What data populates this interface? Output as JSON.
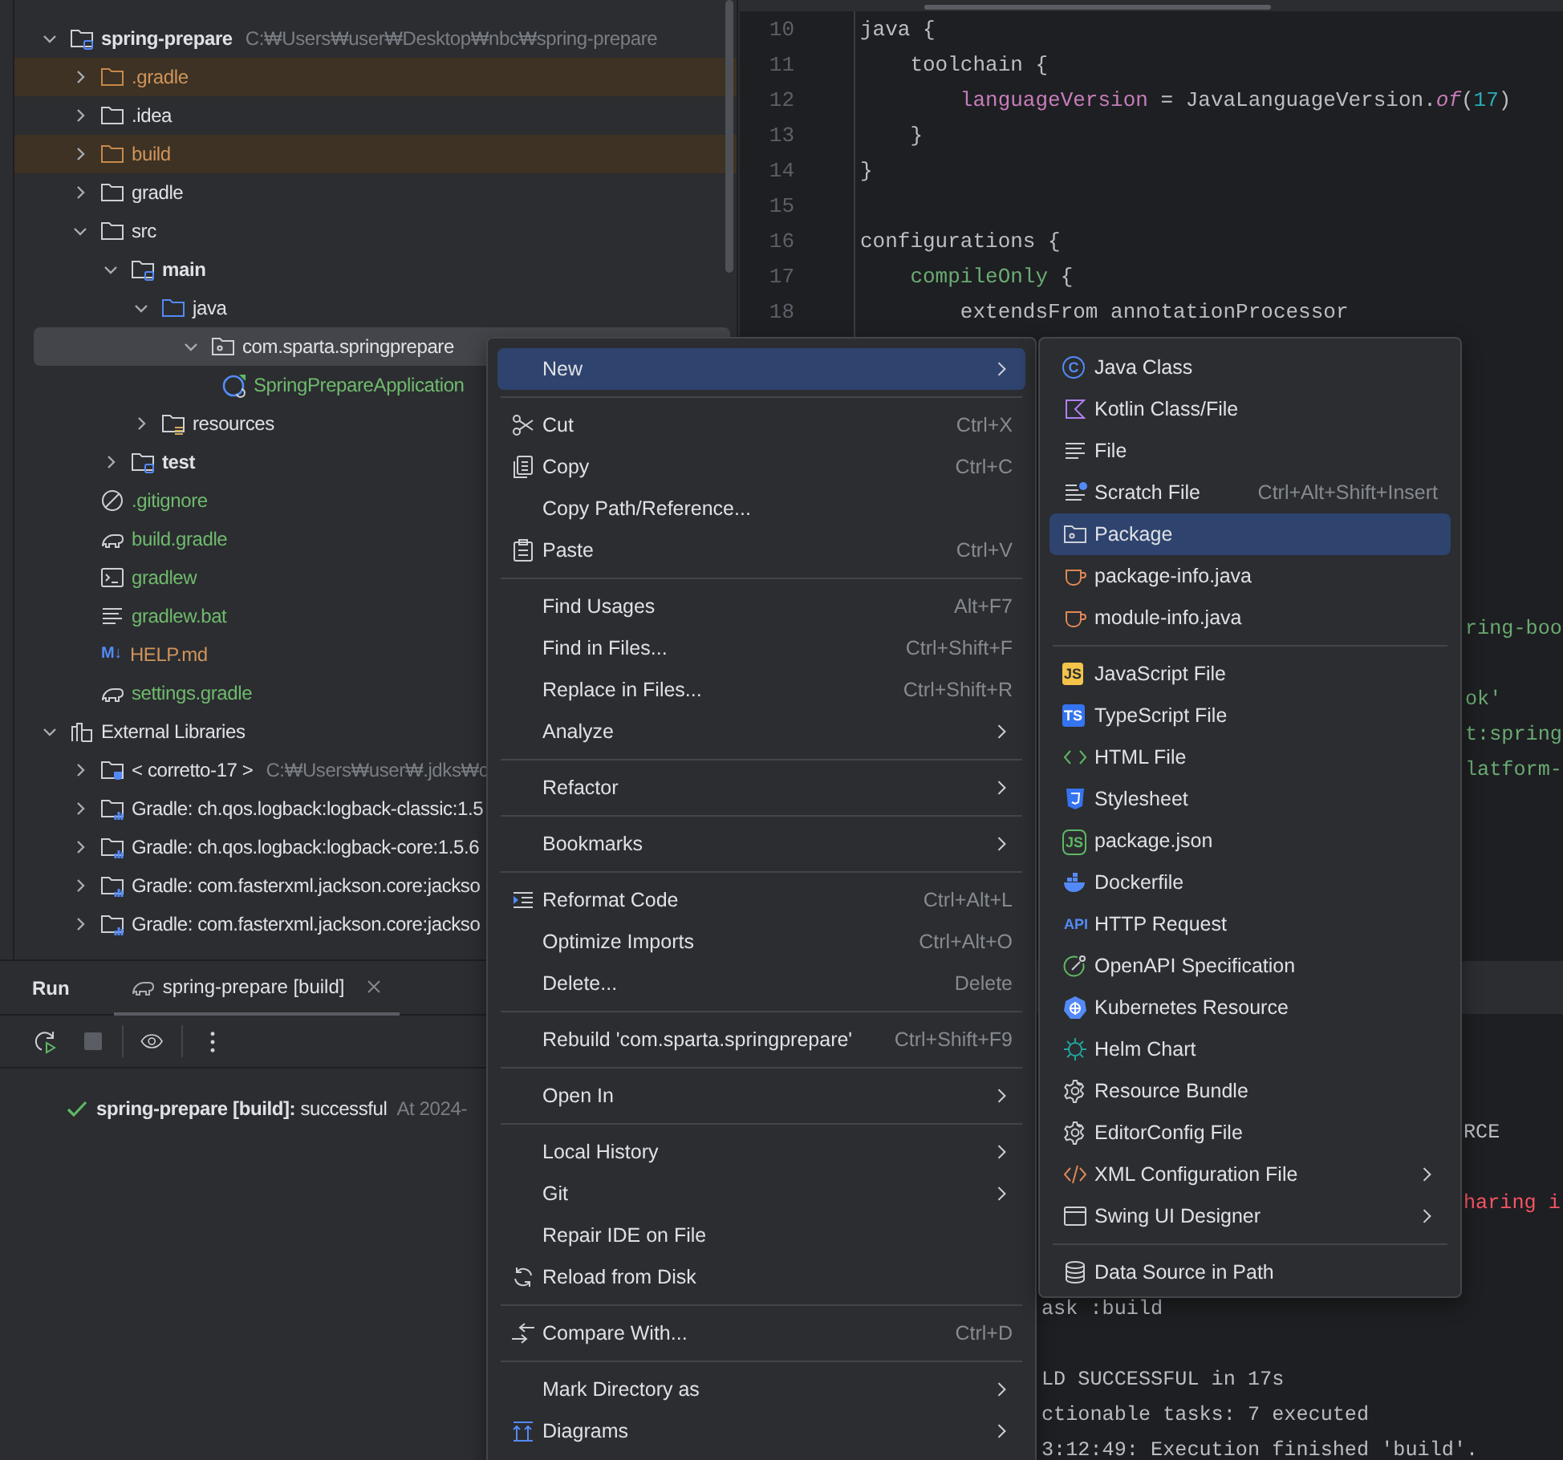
{
  "project_tree": {
    "items": [
      {
        "label": "spring-prepare",
        "hint": "C:₩Users₩user₩Desktop₩nbc₩spring-prepare",
        "kind": "module",
        "color": "#dfe1e5",
        "excluded": false,
        "expanded": true,
        "selected": false,
        "children": [
          {
            "label": ".gradle",
            "kind": "folder",
            "color": "#d0945c",
            "excluded": true,
            "expanded": false,
            "selected": false
          },
          {
            "label": ".idea",
            "kind": "folder",
            "color": "#dfe1e5",
            "excluded": false,
            "expanded": false,
            "selected": false
          },
          {
            "label": "build",
            "kind": "folder",
            "color": "#d0945c",
            "excluded": true,
            "expanded": false,
            "selected": false
          },
          {
            "label": "gradle",
            "kind": "folder",
            "color": "#dfe1e5",
            "excluded": false,
            "expanded": false,
            "selected": false
          },
          {
            "label": "src",
            "kind": "folder",
            "color": "#dfe1e5",
            "excluded": false,
            "expanded": true,
            "selected": false,
            "children": [
              {
                "label": "main",
                "kind": "module",
                "color": "#dfe1e5",
                "excluded": false,
                "expanded": true,
                "selected": false,
                "children": [
                  {
                    "label": "java",
                    "kind": "source",
                    "color": "#dfe1e5",
                    "excluded": false,
                    "expanded": true,
                    "selected": false,
                    "children": [
                      {
                        "label": "com.sparta.springprepare",
                        "kind": "package",
                        "color": "#dfe1e5",
                        "excluded": false,
                        "expanded": true,
                        "selected": true,
                        "children": [
                          {
                            "label": "SpringPrepareApplication",
                            "kind": "spring-class",
                            "color": "#6fba6d",
                            "excluded": false,
                            "selected": false
                          }
                        ]
                      }
                    ]
                  },
                  {
                    "label": "resources",
                    "kind": "resources",
                    "color": "#dfe1e5",
                    "excluded": false,
                    "expanded": false,
                    "selected": false
                  }
                ]
              },
              {
                "label": "test",
                "kind": "module",
                "color": "#dfe1e5",
                "excluded": false,
                "expanded": false,
                "selected": false
              }
            ]
          },
          {
            "label": ".gitignore",
            "kind": "ignore",
            "color": "#6fba6d",
            "excluded": false,
            "selected": false
          },
          {
            "label": "build.gradle",
            "kind": "gradle",
            "color": "#6fba6d",
            "excluded": false,
            "selected": false
          },
          {
            "label": "gradlew",
            "kind": "terminal",
            "color": "#6fba6d",
            "excluded": false,
            "selected": false
          },
          {
            "label": "gradlew.bat",
            "kind": "text",
            "color": "#6fba6d",
            "excluded": false,
            "selected": false
          },
          {
            "label": "HELP.md",
            "kind": "markdown",
            "badge": "M↓",
            "color": "#d0945c",
            "excluded": false,
            "selected": false
          },
          {
            "label": "settings.gradle",
            "kind": "gradle",
            "color": "#6fba6d",
            "excluded": false,
            "selected": false
          }
        ]
      },
      {
        "label": "External Libraries",
        "kind": "libraries",
        "color": "#dfe1e5",
        "excluded": false,
        "expanded": true,
        "selected": false,
        "children": [
          {
            "label": "< corretto-17 >",
            "hint": "C:₩Users₩user₩.jdks₩c",
            "kind": "jdk",
            "color": "#dfe1e5",
            "excluded": false,
            "expanded": false,
            "selected": false
          },
          {
            "label": "Gradle: ch.qos.logback:logback-classic:1.5",
            "kind": "library",
            "color": "#dfe1e5",
            "excluded": false,
            "expanded": false,
            "selected": false
          },
          {
            "label": "Gradle: ch.qos.logback:logback-core:1.5.6",
            "kind": "library",
            "color": "#dfe1e5",
            "excluded": false,
            "expanded": false,
            "selected": false
          },
          {
            "label": "Gradle: com.fasterxml.jackson.core:jackso",
            "kind": "library",
            "color": "#dfe1e5",
            "excluded": false,
            "expanded": false,
            "selected": false
          },
          {
            "label": "Gradle: com.fasterxml.jackson.core:jackso",
            "kind": "library",
            "color": "#dfe1e5",
            "excluded": false,
            "expanded": false,
            "selected": false
          }
        ]
      }
    ]
  },
  "editor": {
    "lines": [
      {
        "number": "10",
        "tokens": [
          {
            "text": "java {",
            "kind": "plain"
          }
        ]
      },
      {
        "number": "11",
        "tokens": [
          {
            "text": "    toolchain {",
            "kind": "plain"
          }
        ]
      },
      {
        "number": "12",
        "tokens": [
          {
            "text": "        languageVersion",
            "kind": "property"
          },
          {
            "text": " = JavaLanguageVersion.",
            "kind": "plain"
          },
          {
            "text": "of",
            "kind": "static"
          },
          {
            "text": "(",
            "kind": "plain"
          },
          {
            "text": "17",
            "kind": "number"
          },
          {
            "text": ")",
            "kind": "plain"
          }
        ]
      },
      {
        "number": "13",
        "tokens": [
          {
            "text": "    }",
            "kind": "plain"
          }
        ]
      },
      {
        "number": "14",
        "tokens": [
          {
            "text": "}",
            "kind": "plain"
          }
        ]
      },
      {
        "number": "15"
      },
      {
        "number": "16",
        "tokens": [
          {
            "text": "configurations {",
            "kind": "plain"
          }
        ]
      },
      {
        "number": "17",
        "tokens": [
          {
            "text": "    compileOnly",
            "kind": "call"
          },
          {
            "text": " {",
            "kind": "plain"
          }
        ]
      },
      {
        "number": "18",
        "tokens": [
          {
            "text": "        extendsFrom annotationProcessor",
            "kind": "plain"
          }
        ]
      }
    ],
    "fragments": [
      {
        "text": "ring-boo",
        "kind": "string"
      },
      {
        "text": "ok'",
        "kind": "string"
      },
      {
        "text": "t:spring",
        "kind": "string"
      },
      {
        "text": "latform-",
        "kind": "string"
      }
    ]
  },
  "run_panel": {
    "title": "Run",
    "tabs": [
      {
        "label": "spring-prepare [build]",
        "selected": true
      }
    ],
    "tree": [
      {
        "label": "**spring-prepare [build]:** successful",
        "time": "At 2024-",
        "kind": "success"
      }
    ],
    "console": [
      {
        "text": "RCE",
        "kind": "output"
      },
      {
        "text": "haring i",
        "kind": "error"
      },
      {
        "text": "ask :build",
        "kind": "output"
      },
      {
        "text": "LD SUCCESSFUL in 17s",
        "kind": "output"
      },
      {
        "text": "ctionable tasks: 7 executed",
        "kind": "output"
      },
      {
        "text": "3:12:49: Execution finished 'build'.",
        "kind": "output"
      }
    ]
  },
  "context_menu": {
    "items": [
      {
        "kind": "item",
        "label": "New",
        "submenu": true,
        "selected": true
      },
      {
        "kind": "separator"
      },
      {
        "kind": "cut",
        "label": "Cut",
        "shortcut": "Ctrl+X",
        "submenu": false,
        "selected": false
      },
      {
        "kind": "copy",
        "label": "Copy",
        "shortcut": "Ctrl+C",
        "submenu": false,
        "selected": false
      },
      {
        "kind": "item",
        "label": "Copy Path/Reference...",
        "submenu": false,
        "selected": false
      },
      {
        "kind": "paste",
        "label": "Paste",
        "shortcut": "Ctrl+V",
        "submenu": false,
        "selected": false
      },
      {
        "kind": "separator"
      },
      {
        "kind": "item",
        "label": "Find Usages",
        "shortcut": "Alt+F7",
        "submenu": false,
        "selected": false
      },
      {
        "kind": "item",
        "label": "Find in Files...",
        "shortcut": "Ctrl+Shift+F",
        "submenu": false,
        "selected": false
      },
      {
        "kind": "item",
        "label": "Replace in Files...",
        "shortcut": "Ctrl+Shift+R",
        "submenu": false,
        "selected": false
      },
      {
        "kind": "item",
        "label": "Analyze",
        "submenu": true,
        "selected": false
      },
      {
        "kind": "separator"
      },
      {
        "kind": "item",
        "label": "Refactor",
        "submenu": true,
        "selected": false
      },
      {
        "kind": "separator"
      },
      {
        "kind": "item",
        "label": "Bookmarks",
        "submenu": true,
        "selected": false
      },
      {
        "kind": "separator"
      },
      {
        "kind": "reformat",
        "label": "Reformat Code",
        "shortcut": "Ctrl+Alt+L",
        "submenu": false,
        "selected": false
      },
      {
        "kind": "item",
        "label": "Optimize Imports",
        "shortcut": "Ctrl+Alt+O",
        "submenu": false,
        "selected": false
      },
      {
        "kind": "item",
        "label": "Delete...",
        "shortcut": "Delete",
        "submenu": false,
        "selected": false
      },
      {
        "kind": "separator"
      },
      {
        "kind": "item",
        "label": "Rebuild 'com.sparta.springprepare'",
        "shortcut": "Ctrl+Shift+F9",
        "submenu": false,
        "selected": false
      },
      {
        "kind": "separator"
      },
      {
        "kind": "item",
        "label": "Open In",
        "submenu": true,
        "selected": false
      },
      {
        "kind": "separator"
      },
      {
        "kind": "item",
        "label": "Local History",
        "submenu": true,
        "selected": false
      },
      {
        "kind": "item",
        "label": "Git",
        "submenu": true,
        "selected": false
      },
      {
        "kind": "item",
        "label": "Repair IDE on File",
        "submenu": false,
        "selected": false
      },
      {
        "kind": "reload",
        "label": "Reload from Disk",
        "submenu": false,
        "selected": false
      },
      {
        "kind": "separator"
      },
      {
        "kind": "compare",
        "label": "Compare With...",
        "shortcut": "Ctrl+D",
        "submenu": false,
        "selected": false
      },
      {
        "kind": "separator"
      },
      {
        "kind": "item",
        "label": "Mark Directory as",
        "submenu": true,
        "selected": false
      },
      {
        "kind": "diagrams",
        "label": "Diagrams",
        "submenu": true,
        "selected": false
      }
    ]
  },
  "new_submenu": {
    "items": [
      {
        "kind": "class",
        "label": "Java Class",
        "badge": "C",
        "submenu": false,
        "selected": false
      },
      {
        "kind": "kotlin",
        "label": "Kotlin Class/File",
        "submenu": false,
        "selected": false
      },
      {
        "kind": "text",
        "label": "File",
        "submenu": false,
        "selected": false
      },
      {
        "kind": "scratch",
        "label": "Scratch File",
        "shortcut": "Ctrl+Alt+Shift+Insert",
        "submenu": false,
        "selected": false
      },
      {
        "kind": "package",
        "label": "Package",
        "submenu": false,
        "selected": true
      },
      {
        "kind": "cup",
        "label": "package-info.java",
        "submenu": false,
        "selected": false
      },
      {
        "kind": "cup",
        "label": "module-info.java",
        "submenu": false,
        "selected": false
      },
      {
        "kind": "separator"
      },
      {
        "kind": "js",
        "label": "JavaScript File",
        "badge": "JS",
        "submenu": false,
        "selected": false
      },
      {
        "kind": "ts",
        "label": "TypeScript File",
        "badge": "TS",
        "submenu": false,
        "selected": false
      },
      {
        "kind": "html",
        "label": "HTML File",
        "submenu": false,
        "selected": false
      },
      {
        "kind": "css",
        "label": "Stylesheet",
        "submenu": false,
        "selected": false
      },
      {
        "kind": "node",
        "label": "package.json",
        "badge": "JS",
        "submenu": false,
        "selected": false
      },
      {
        "kind": "docker",
        "label": "Dockerfile",
        "submenu": false,
        "selected": false
      },
      {
        "kind": "api",
        "label": "HTTP Request",
        "badge": "API",
        "submenu": false,
        "selected": false
      },
      {
        "kind": "openapi",
        "label": "OpenAPI Specification",
        "submenu": false,
        "selected": false
      },
      {
        "kind": "kubernetes",
        "label": "Kubernetes Resource",
        "submenu": false,
        "selected": false
      },
      {
        "kind": "helm",
        "label": "Helm Chart",
        "submenu": false,
        "selected": false
      },
      {
        "kind": "gear",
        "label": "Resource Bundle",
        "submenu": false,
        "selected": false
      },
      {
        "kind": "gear",
        "label": "EditorConfig File",
        "submenu": false,
        "selected": false
      },
      {
        "kind": "xml",
        "label": "XML Configuration File",
        "submenu": true,
        "selected": false
      },
      {
        "kind": "window",
        "label": "Swing UI Designer",
        "submenu": true,
        "selected": false
      },
      {
        "kind": "separator"
      },
      {
        "kind": "database",
        "label": "Data Source in Path",
        "submenu": false,
        "selected": false
      }
    ]
  }
}
